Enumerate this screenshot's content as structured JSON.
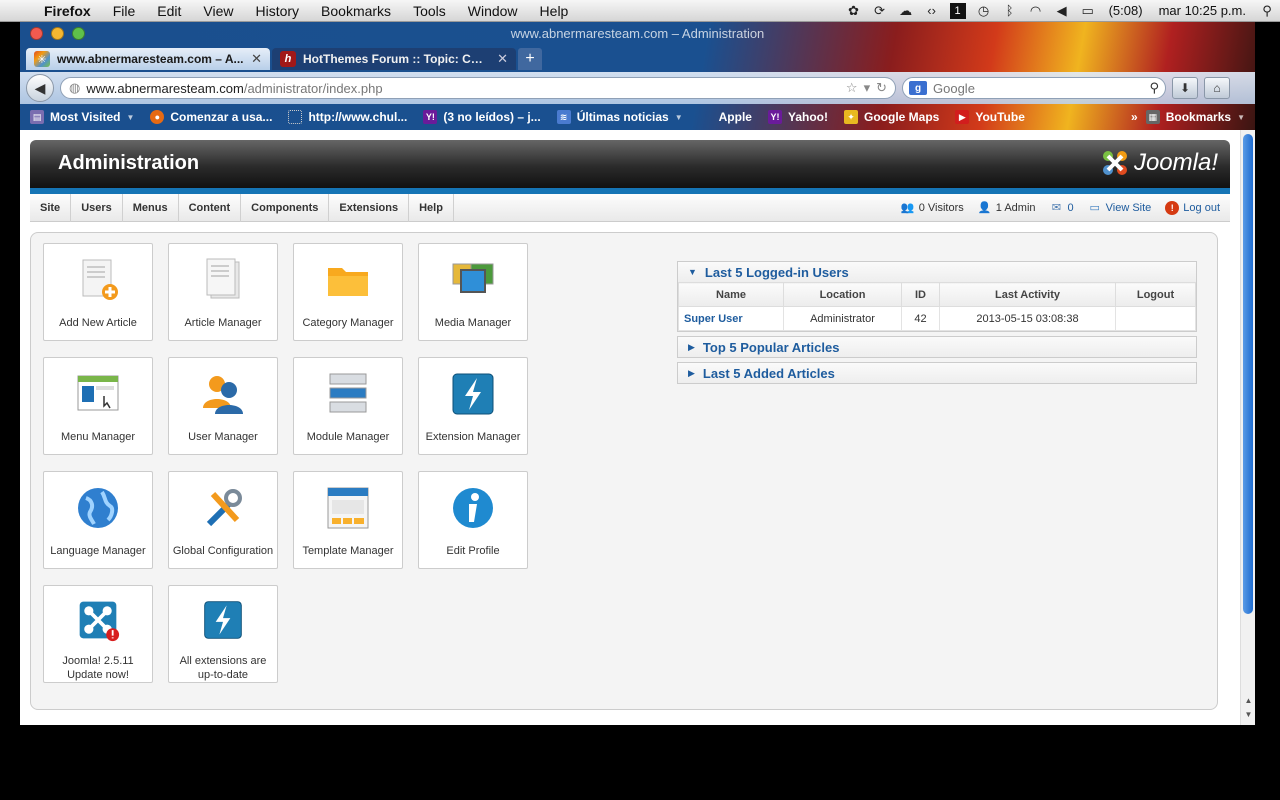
{
  "menubar": {
    "app_name": "Firefox",
    "items": [
      "File",
      "Edit",
      "View",
      "History",
      "Bookmarks",
      "Tools",
      "Window",
      "Help"
    ],
    "battery": "(5:08)",
    "clock": "mar 10:25 p.m.",
    "status_icons": [
      "evernote-icon",
      "sync-icon",
      "cloud-icon",
      "code-icon",
      "one-icon",
      "time-machine-icon",
      "bluetooth-icon",
      "wifi-icon",
      "volume-icon",
      "battery-icon"
    ]
  },
  "window": {
    "title": "www.abnermaresteam.com – Administration",
    "tabs": [
      {
        "label": "www.abnermaresteam.com – A...",
        "active": true
      },
      {
        "label": "HotThemes Forum :: Topic: CHA...",
        "active": false
      }
    ],
    "url_domain": "www.abnermaresteam.com",
    "url_path": "/administrator/index.php",
    "search_placeholder": "Google",
    "bookmarks": [
      {
        "label": "Most Visited",
        "icon": "most-visited-icon",
        "dropdown": true
      },
      {
        "label": "Comenzar a usa...",
        "icon": "firefox-icon",
        "dropdown": false
      },
      {
        "label": "http://www.chul...",
        "icon": "page-icon",
        "dropdown": false
      },
      {
        "label": "(3 no leídos) – j...",
        "icon": "yahoo-icon",
        "dropdown": false
      },
      {
        "label": "Últimas noticias",
        "icon": "rss-icon",
        "dropdown": true
      },
      {
        "label": "Apple",
        "icon": "apple-icon",
        "dropdown": false
      },
      {
        "label": "Yahoo!",
        "icon": "yahoo-icon",
        "dropdown": false
      },
      {
        "label": "Google Maps",
        "icon": "maps-icon",
        "dropdown": false
      },
      {
        "label": "YouTube",
        "icon": "youtube-icon",
        "dropdown": false
      }
    ],
    "bookmarks_menu": "Bookmarks"
  },
  "admin": {
    "title": "Administration",
    "logo_text": "Joomla!",
    "main_menu": [
      "Site",
      "Users",
      "Menus",
      "Content",
      "Components",
      "Extensions",
      "Help"
    ],
    "status": {
      "visitors": "0 Visitors",
      "admins": "1 Admin",
      "messages": "0",
      "view_site": "View Site",
      "logout": "Log out"
    }
  },
  "quickicons": [
    {
      "label": "Add New Article",
      "icon": "add-article-icon"
    },
    {
      "label": "Article Manager",
      "icon": "article-icon"
    },
    {
      "label": "Category Manager",
      "icon": "folder-icon"
    },
    {
      "label": "Media Manager",
      "icon": "media-icon"
    },
    {
      "label": "Menu Manager",
      "icon": "menu-icon"
    },
    {
      "label": "User Manager",
      "icon": "users-icon"
    },
    {
      "label": "Module Manager",
      "icon": "module-icon"
    },
    {
      "label": "Extension Manager",
      "icon": "extension-icon"
    },
    {
      "label": "Language Manager",
      "icon": "globe-icon"
    },
    {
      "label": "Global Configuration",
      "icon": "tools-icon"
    },
    {
      "label": "Template Manager",
      "icon": "template-icon"
    },
    {
      "label": "Edit Profile",
      "icon": "info-icon"
    },
    {
      "label": "Joomla! 2.5.11\nUpdate now!",
      "icon": "joomla-update-icon"
    },
    {
      "label": "All extensions are\nup-to-date",
      "icon": "extension-uptodate-icon"
    }
  ],
  "modules": {
    "logged_in": {
      "title": "Last 5 Logged-in Users",
      "columns": [
        "Name",
        "Location",
        "ID",
        "Last Activity",
        "Logout"
      ],
      "rows": [
        {
          "name": "Super User",
          "location": "Administrator",
          "id": "42",
          "last_activity": "2013-05-15 03:08:38",
          "logout": ""
        }
      ]
    },
    "popular": {
      "title": "Top 5 Popular Articles"
    },
    "added": {
      "title": "Last 5 Added Articles"
    }
  },
  "colors": {
    "accent": "#1574b5",
    "link": "#1e5c9e"
  }
}
